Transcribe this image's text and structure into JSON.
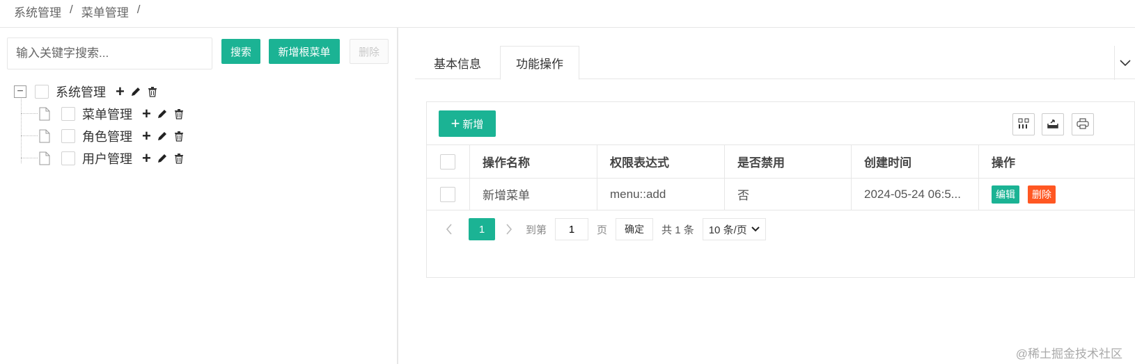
{
  "breadcrumb": {
    "items": [
      "系统管理",
      "菜单管理"
    ],
    "separator": "/"
  },
  "left": {
    "search": {
      "placeholder": "输入关键字搜索..."
    },
    "search_button": "搜索",
    "add_root_button": "新增根菜单",
    "delete_button": "删除",
    "tree": {
      "root": {
        "label": "系统管理",
        "expanded": true
      },
      "children": [
        {
          "label": "菜单管理"
        },
        {
          "label": "角色管理"
        },
        {
          "label": "用户管理"
        }
      ],
      "actions": {
        "add": "+"
      }
    }
  },
  "right": {
    "tabs": [
      {
        "label": "基本信息",
        "active": false
      },
      {
        "label": "功能操作",
        "active": true
      }
    ],
    "toolbar": {
      "add_button": "新增"
    },
    "table": {
      "columns": [
        "操作名称",
        "权限表达式",
        "是否禁用",
        "创建时间",
        "操作"
      ],
      "rows": [
        {
          "name": "新增菜单",
          "permission": "menu::add",
          "disabled": "否",
          "created": "2024-05-24 06:5...",
          "edit": "编辑",
          "delete": "删除"
        }
      ]
    },
    "pager": {
      "current": "1",
      "goto_label": "到第",
      "goto_value": "1",
      "page_unit": "页",
      "confirm": "确定",
      "total": "共 1 条",
      "page_size": "10 条/页"
    }
  },
  "colors": {
    "accent": "#1bb394",
    "danger": "#ff5722"
  },
  "watermark": "@稀土掘金技术社区"
}
